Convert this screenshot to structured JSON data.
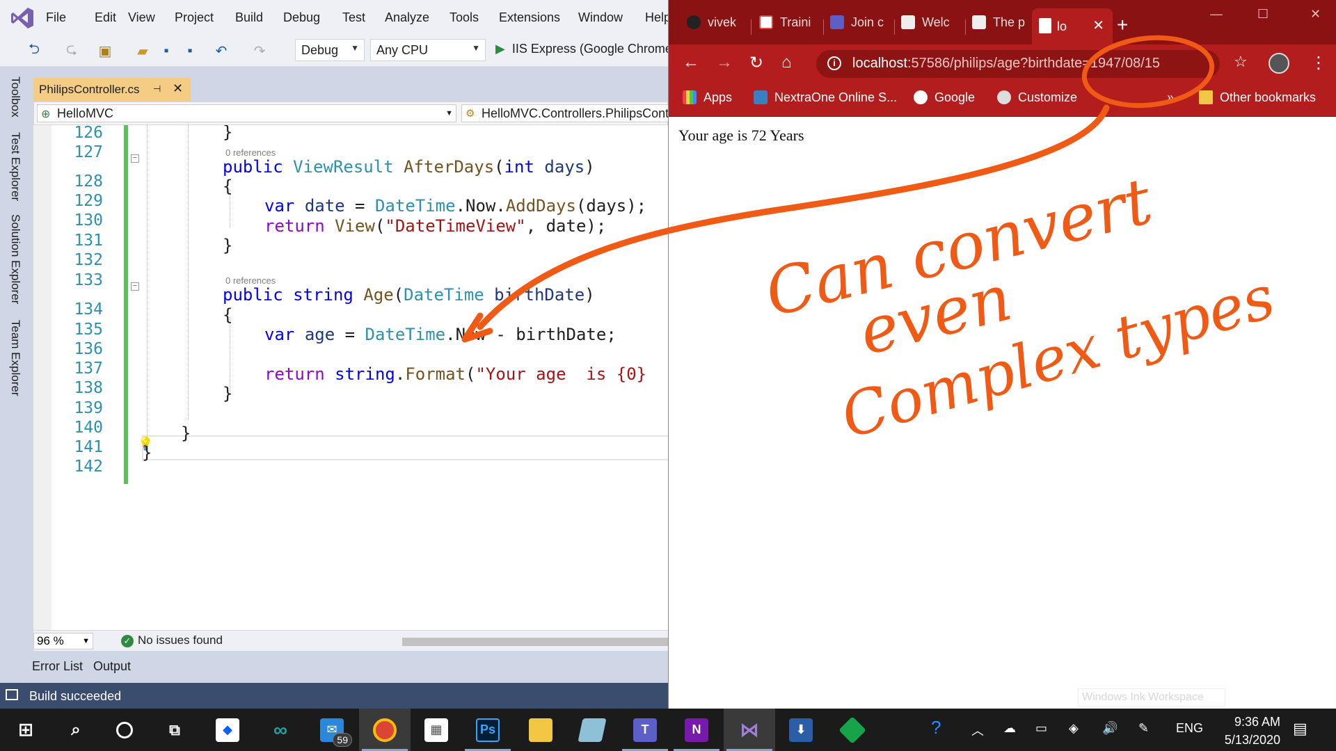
{
  "vs": {
    "menu": [
      "File",
      "Edit",
      "View",
      "Project",
      "Build",
      "Debug",
      "Test",
      "Analyze",
      "Tools",
      "Extensions",
      "Window",
      "Help"
    ],
    "config": "Debug",
    "platform": "Any CPU",
    "run_target": "IIS Express (Google Chrome",
    "side_tabs": [
      "Toolbox",
      "Test Explorer",
      "Solution Explorer",
      "Team Explorer"
    ],
    "file_tab": "PhilipsController.cs",
    "nav_project": "HelloMVC",
    "nav_class": "HelloMVC.Controllers.PhilipsContro",
    "code": {
      "line_numbers": [
        "126",
        "127",
        "128",
        "129",
        "130",
        "131",
        "132",
        "133",
        "134",
        "135",
        "136",
        "137",
        "138",
        "139",
        "140",
        "141",
        "142"
      ],
      "refs_1": "0 references",
      "refs_2": "0 references",
      "l126": "}",
      "l128_kw": "public",
      "l128_type": "ViewResult",
      "l128_method": "AfterDays",
      "l128_open": "(",
      "l128_int": "int",
      "l128_param": "days",
      "l128_close": ")",
      "l129": "{",
      "l130_var": "var",
      "l130_name": "date",
      "l130_eq": " = ",
      "l130_type": "DateTime",
      "l130_rest": ".Now.",
      "l130_method": "AddDays",
      "l130_args": "(days);",
      "l131_ret": "return",
      "l131_method": "View",
      "l131_open": "(",
      "l131_str": "\"DateTimeView\"",
      "l131_rest": ", date);",
      "l132": "}",
      "l134_kw": "public",
      "l134_str": "string",
      "l134_method": "Age",
      "l134_open": "(",
      "l134_type": "DateTime",
      "l134_param": "birthDate",
      "l134_close": ")",
      "l135": "{",
      "l136_var": "var",
      "l136_name": "age",
      "l136_eq": " = ",
      "l136_type": "DateTime",
      "l136_rest": ".Now - birthDate;",
      "l138_ret": "return",
      "l138_str": "string",
      "l138_dot": ".",
      "l138_method": "Format",
      "l138_open": "(",
      "l138_lit": "\"Your age  is {0}",
      "l139": "}",
      "l141": "}",
      "l142": "}"
    },
    "zoom": "96 %",
    "issues": "No issues found",
    "bottom_tabs": [
      "Error List",
      "Output"
    ],
    "status": "Build succeeded"
  },
  "chrome": {
    "tabs": [
      "vivek",
      "Traini",
      "Join c",
      "Welc",
      "The p"
    ],
    "active_tab": "lo",
    "url_host": "localhost",
    "url_path": ":57586/philips/age?birthdate=1947/08/15",
    "bookmarks": [
      "Apps",
      "NextraOne Online S...",
      "Google",
      "Customize"
    ],
    "more": "»",
    "other_bookmarks": "Other bookmarks",
    "page_text": "Your age is 72 Years",
    "ink_workspace": "Windows Ink Workspace"
  },
  "annotation": {
    "handwriting": [
      "Can convert",
      "even",
      "Complex types"
    ],
    "color": "#f05a14"
  },
  "taskbar": {
    "mail_badge": "59",
    "lang": "ENG",
    "time": "9:36 AM",
    "date": "5/13/2020"
  }
}
